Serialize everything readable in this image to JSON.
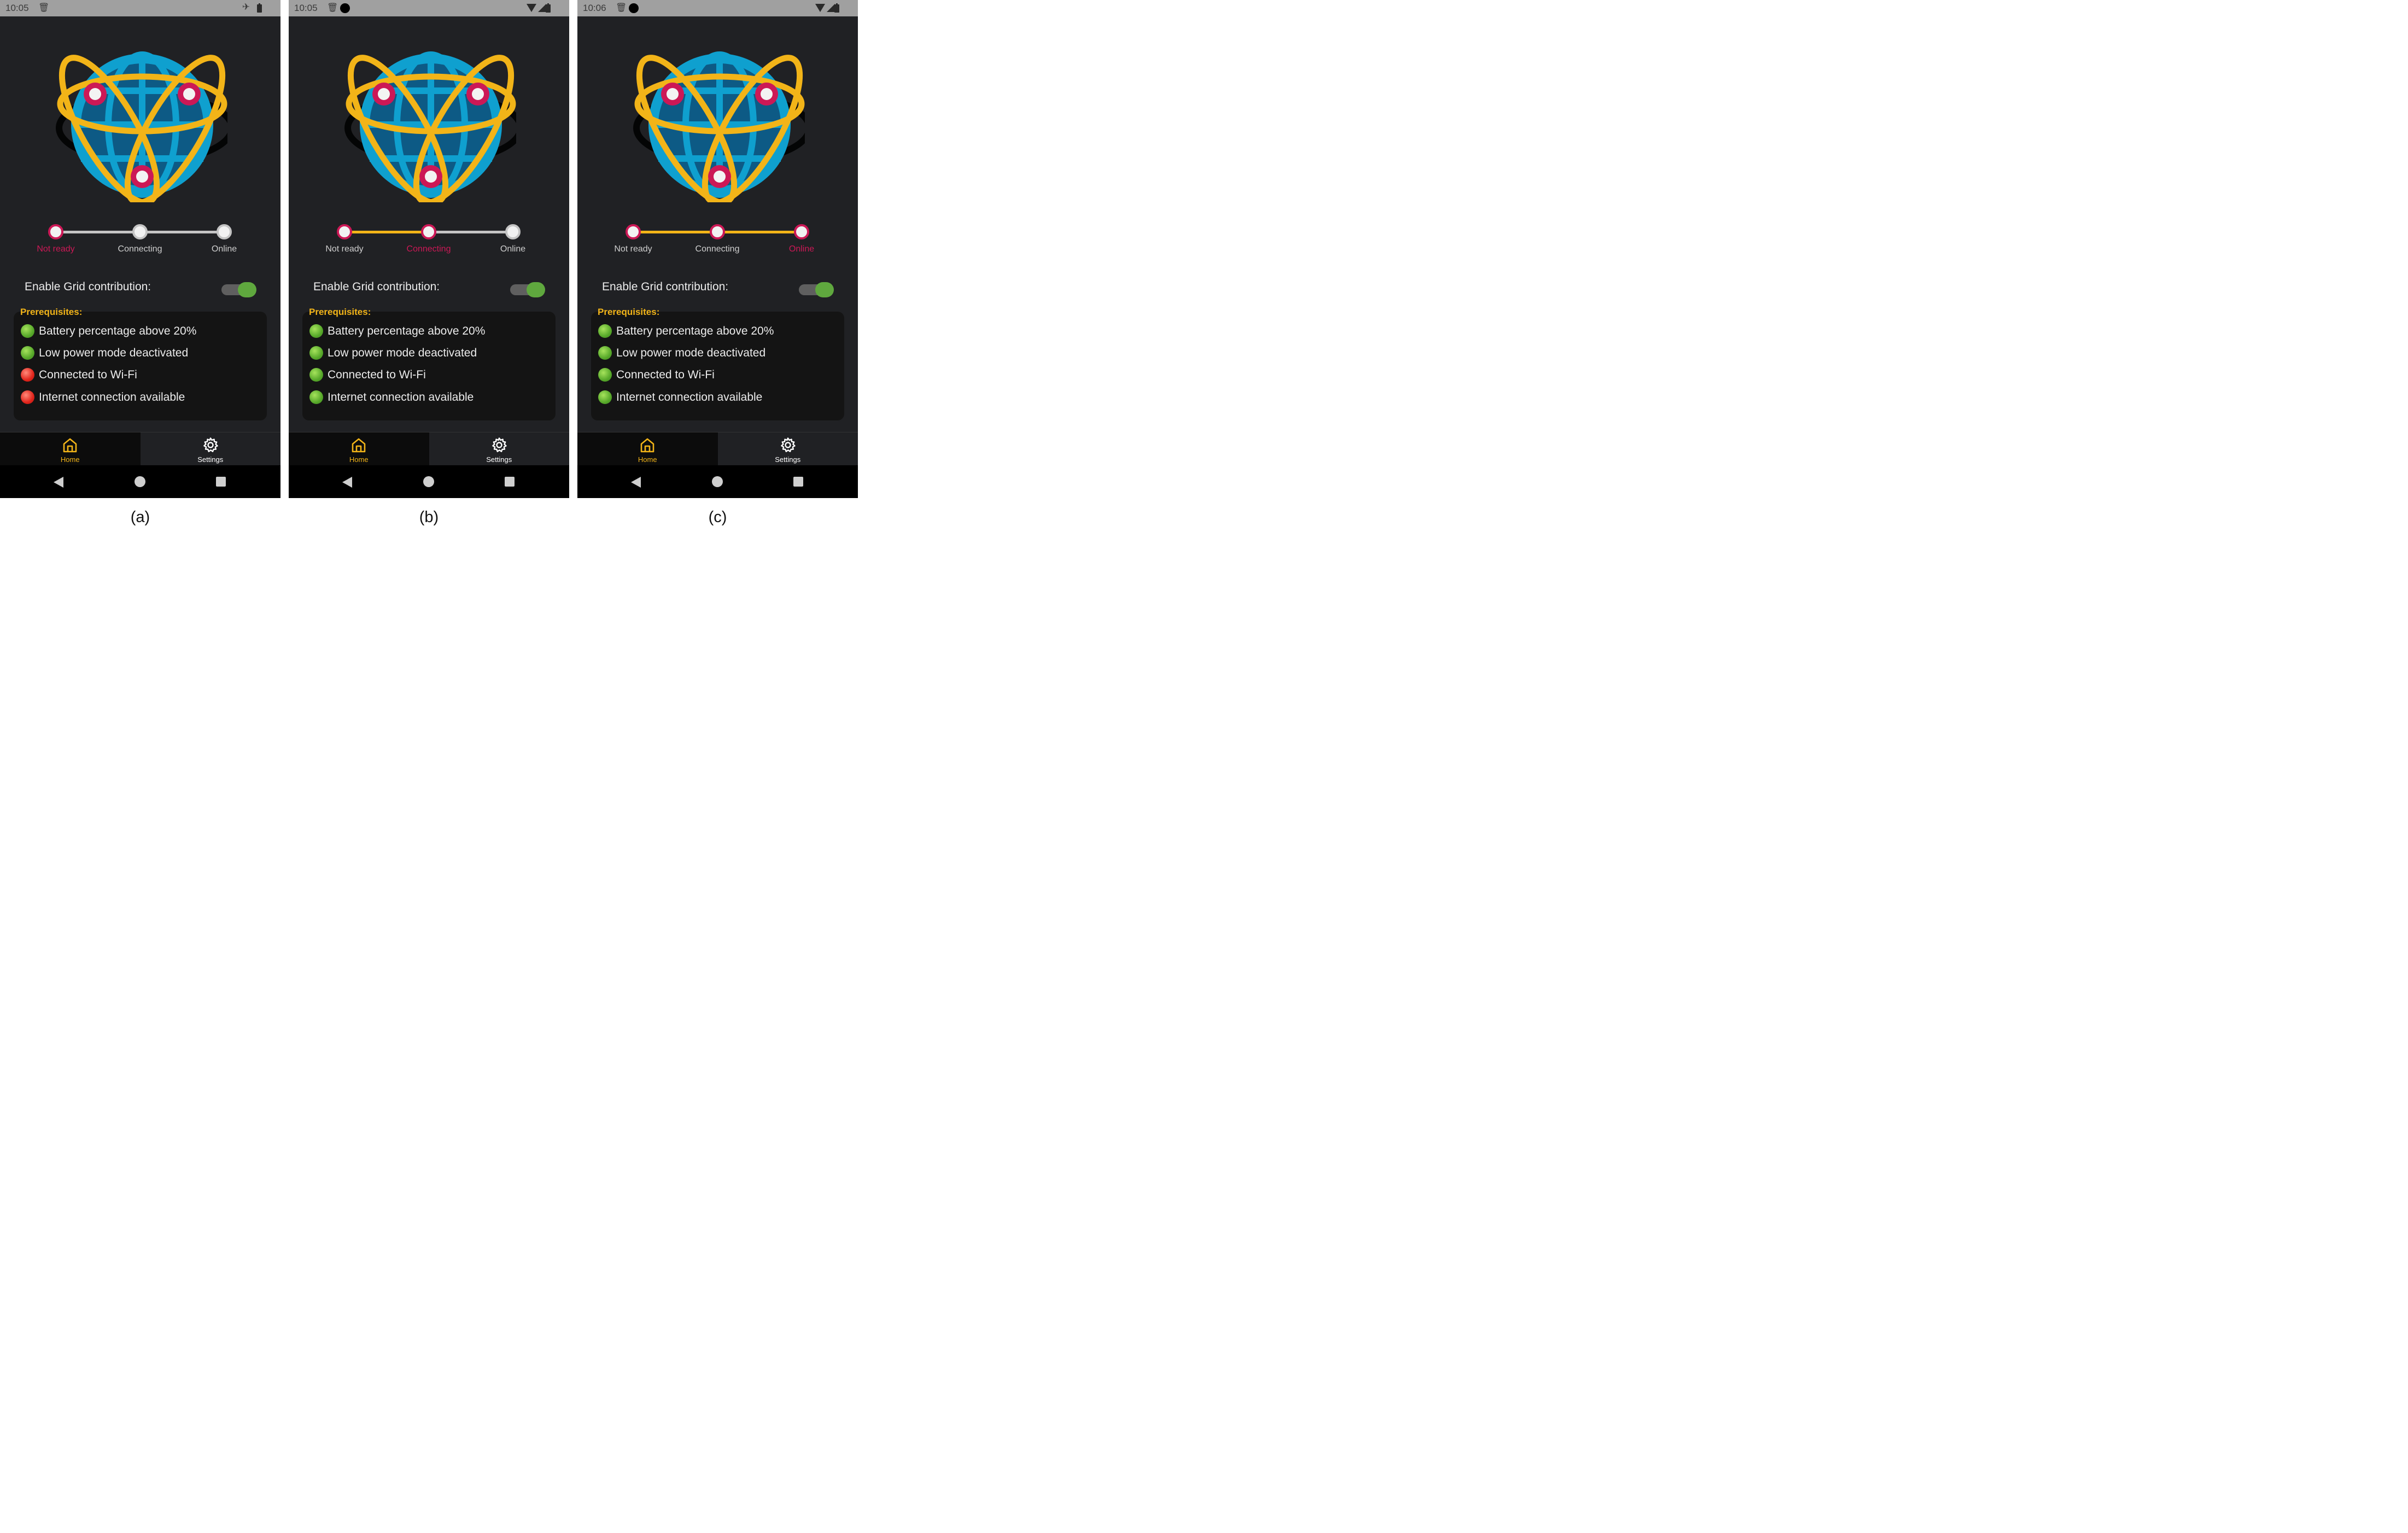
{
  "figure": {
    "panels": [
      {
        "caption": "(a)",
        "status_bar": {
          "time": "10:05",
          "icons": [
            "sim-icon",
            "airplane-icon",
            "battery-icon"
          ]
        },
        "stepper": {
          "steps": [
            "Not ready",
            "Connecting",
            "Online"
          ],
          "active_index": 0,
          "segments": [
            "pending",
            "pending"
          ],
          "step_states": [
            "done",
            "pending",
            "pending"
          ]
        },
        "grid_toggle": {
          "label": "Enable Grid contribution:",
          "on": true
        },
        "prerequisites": {
          "title": "Prerequisites:",
          "items": [
            {
              "text": "Battery percentage above 20%",
              "status": "ok"
            },
            {
              "text": "Low power mode deactivated",
              "status": "ok"
            },
            {
              "text": "Connected to Wi-Fi",
              "status": "fail"
            },
            {
              "text": "Internet connection available",
              "status": "fail"
            }
          ]
        },
        "nav": {
          "home": "Home",
          "settings": "Settings"
        }
      },
      {
        "caption": "(b)",
        "status_bar": {
          "time": "10:05",
          "icons": [
            "sim-icon",
            "notification-dot-icon",
            "wifi-icon",
            "signal-icon",
            "battery-icon"
          ]
        },
        "stepper": {
          "steps": [
            "Not ready",
            "Connecting",
            "Online"
          ],
          "active_index": 1,
          "segments": [
            "done",
            "pending"
          ],
          "step_states": [
            "done",
            "done",
            "pending"
          ]
        },
        "grid_toggle": {
          "label": "Enable Grid contribution:",
          "on": true
        },
        "prerequisites": {
          "title": "Prerequisites:",
          "items": [
            {
              "text": "Battery percentage above 20%",
              "status": "ok"
            },
            {
              "text": "Low power mode deactivated",
              "status": "ok"
            },
            {
              "text": "Connected to Wi-Fi",
              "status": "ok"
            },
            {
              "text": "Internet connection available",
              "status": "ok"
            }
          ]
        },
        "nav": {
          "home": "Home",
          "settings": "Settings"
        }
      },
      {
        "caption": "(c)",
        "status_bar": {
          "time": "10:06",
          "icons": [
            "sim-icon",
            "notification-dot-icon",
            "wifi-icon",
            "signal-icon",
            "battery-icon"
          ]
        },
        "stepper": {
          "steps": [
            "Not ready",
            "Connecting",
            "Online"
          ],
          "active_index": 2,
          "segments": [
            "done",
            "done"
          ],
          "step_states": [
            "done",
            "done",
            "done"
          ]
        },
        "grid_toggle": {
          "label": "Enable Grid contribution:",
          "on": true
        },
        "prerequisites": {
          "title": "Prerequisites:",
          "items": [
            {
              "text": "Battery percentage above 20%",
              "status": "ok"
            },
            {
              "text": "Low power mode deactivated",
              "status": "ok"
            },
            {
              "text": "Connected to Wi-Fi",
              "status": "ok"
            },
            {
              "text": "Internet connection available",
              "status": "ok"
            }
          ]
        },
        "nav": {
          "home": "Home",
          "settings": "Settings"
        }
      }
    ],
    "colors": {
      "background": "#202124",
      "accent_yellow": "#f2b418",
      "accent_magenta": "#cc1856",
      "globe_light": "#0fa0cf",
      "globe_dark": "#0d5a85",
      "toggle_on": "#5fa83e",
      "status_ok": "#57a82a",
      "status_fail": "#e0241b"
    }
  }
}
